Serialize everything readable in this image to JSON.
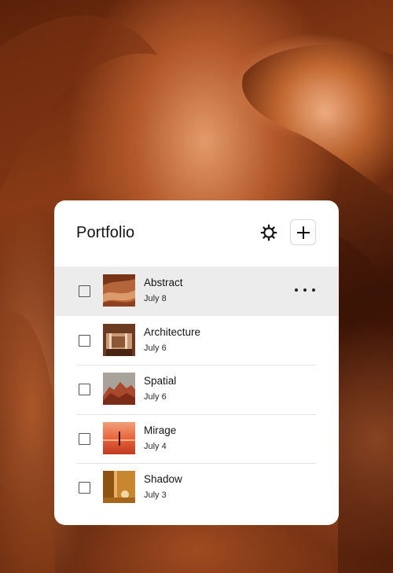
{
  "panel": {
    "title": "Portfolio",
    "settings_icon": "gear-icon",
    "add_icon": "plus-icon"
  },
  "items": [
    {
      "name": "Abstract",
      "date": "July 8",
      "selected": true,
      "thumbnail": "abstract-thumbnail"
    },
    {
      "name": "Architecture",
      "date": "July 6",
      "selected": false,
      "thumbnail": "architecture-thumbnail"
    },
    {
      "name": "Spatial",
      "date": "July 6",
      "selected": false,
      "thumbnail": "spatial-thumbnail"
    },
    {
      "name": "Mirage",
      "date": "July 4",
      "selected": false,
      "thumbnail": "mirage-thumbnail"
    },
    {
      "name": "Shadow",
      "date": "July 3",
      "selected": false,
      "thumbnail": "shadow-thumbnail"
    }
  ],
  "colors": {
    "selected_row": "#ececec",
    "accent_copper": "#c46a3a"
  }
}
